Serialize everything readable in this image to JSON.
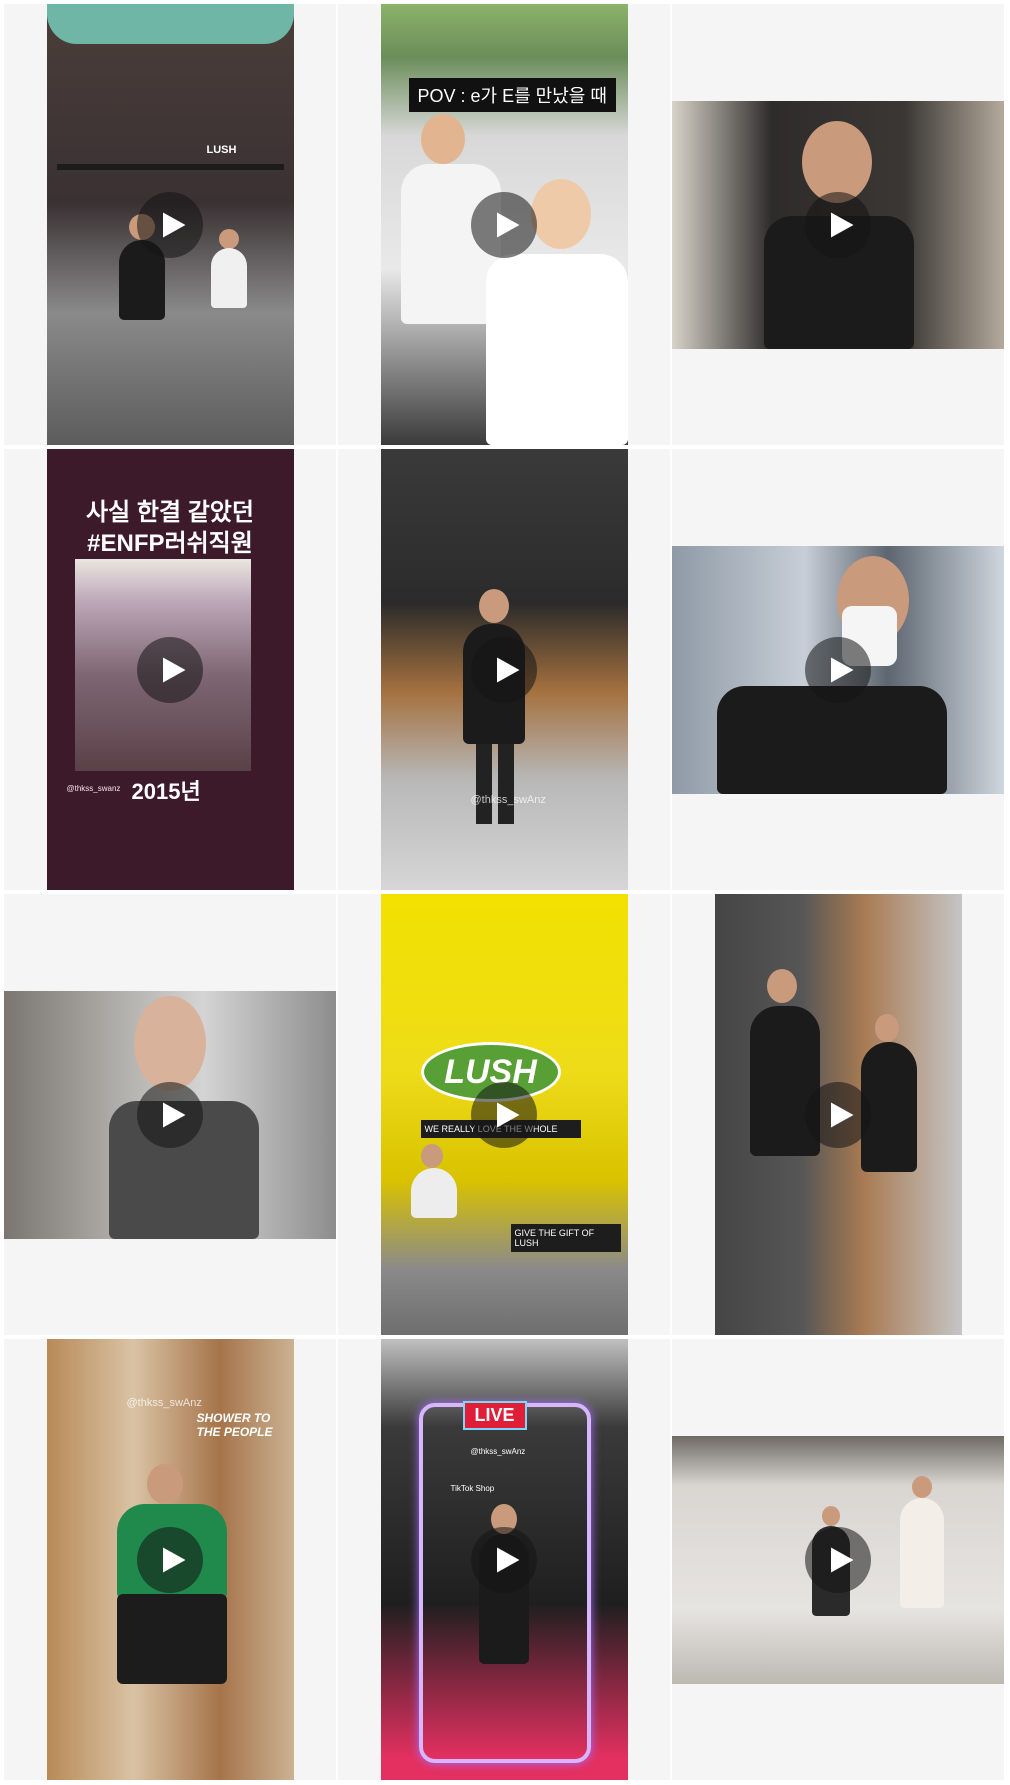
{
  "grid": {
    "tiles": [
      {
        "id": 1,
        "name": "tile-1",
        "media": "video",
        "orientation": "portrait",
        "scene": "storefront-dance",
        "overlay": {
          "store_sign": "LUSH"
        }
      },
      {
        "id": 2,
        "name": "tile-2",
        "media": "video",
        "orientation": "portrait",
        "scene": "crowd-festival",
        "overlay": {
          "caption": "POV : e가 E를 만났을 때"
        }
      },
      {
        "id": 3,
        "name": "tile-3",
        "media": "video",
        "orientation": "landscape",
        "scene": "store-selfie"
      },
      {
        "id": 4,
        "name": "tile-4",
        "media": "video",
        "orientation": "portrait",
        "scene": "poster",
        "overlay": {
          "title_line1": "사실 한결 같았던",
          "title_line2": "#ENFP러쉬직원",
          "handle": "@thkss_swanz",
          "year": "2015년"
        }
      },
      {
        "id": 5,
        "name": "tile-5",
        "media": "video",
        "orientation": "portrait",
        "scene": "store-dance",
        "overlay": {
          "watermark": "@thkss_swAnz"
        }
      },
      {
        "id": 6,
        "name": "tile-6",
        "media": "video",
        "orientation": "landscape",
        "scene": "window-selfie"
      },
      {
        "id": 7,
        "name": "tile-7",
        "media": "video",
        "orientation": "landscape",
        "scene": "outdoor-selfie"
      },
      {
        "id": 8,
        "name": "tile-8",
        "media": "video",
        "orientation": "portrait",
        "scene": "yellow-store",
        "overlay": {
          "logo": "LUSH",
          "board_top": "WE REALLY LOVE THE WHOLE",
          "board_bottom": "GIVE THE GIFT OF LUSH"
        }
      },
      {
        "id": 9,
        "name": "tile-9",
        "media": "video",
        "orientation": "portrait",
        "scene": "two-dancers"
      },
      {
        "id": 10,
        "name": "tile-10",
        "media": "video",
        "orientation": "portrait",
        "scene": "green-hoodie",
        "overlay": {
          "sign": "SHOWER TO THE PEOPLE",
          "handle": "@thkss_swAnz"
        }
      },
      {
        "id": 11,
        "name": "tile-11",
        "media": "video",
        "orientation": "portrait",
        "scene": "neon-live",
        "overlay": {
          "badge": "LIVE",
          "handle": "@thkss_swAnz",
          "shop": "TikTok Shop"
        }
      },
      {
        "id": 12,
        "name": "tile-12",
        "media": "video",
        "orientation": "landscape",
        "scene": "two-dancers-indoor"
      }
    ]
  },
  "icons": {
    "play": "play-icon"
  },
  "colors": {
    "tile_background": "#f5f5f6",
    "play_circle": "rgba(20,20,20,0.55)",
    "play_triangle": "#ffffff"
  }
}
